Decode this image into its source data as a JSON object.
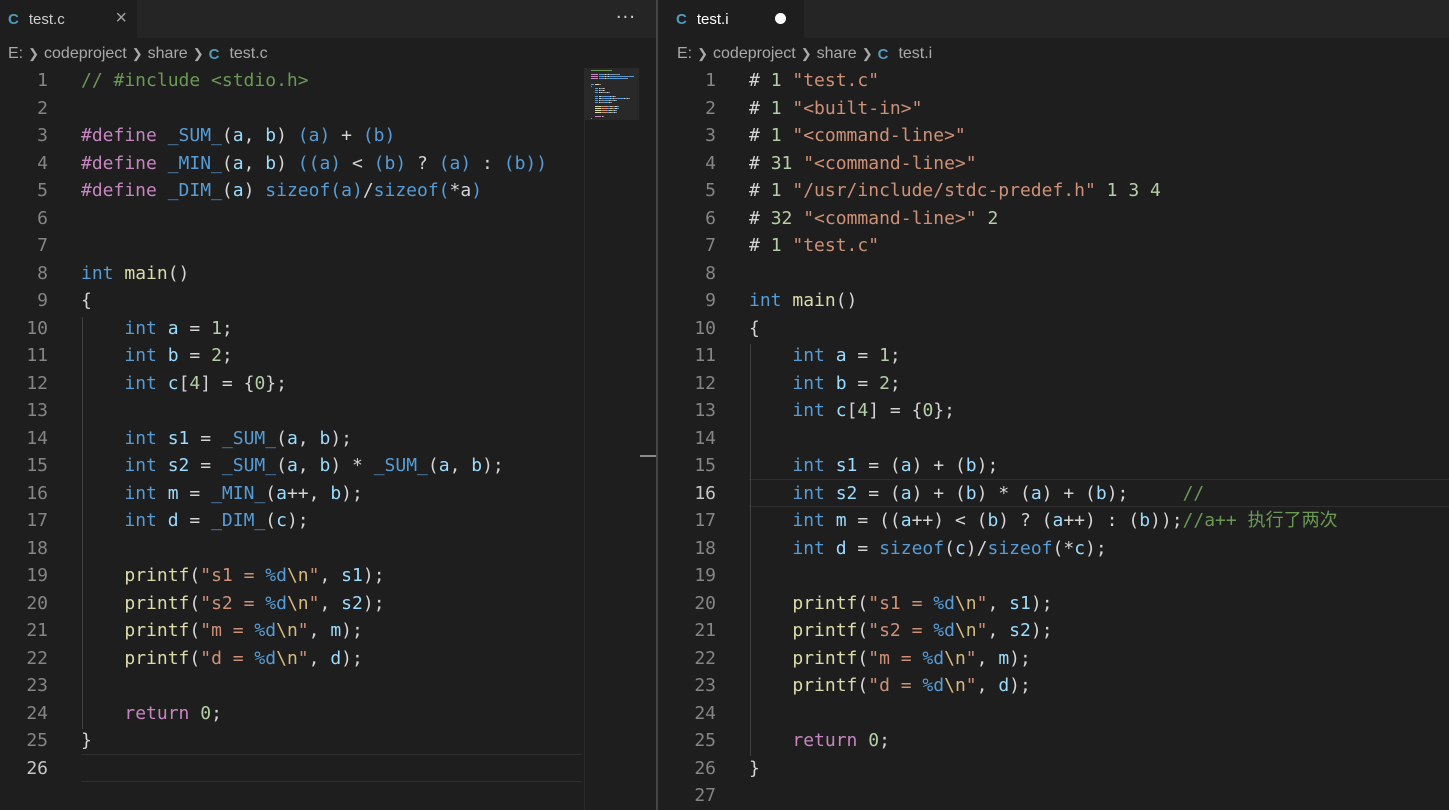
{
  "left_editor": {
    "tab": {
      "label": "test.c",
      "icon": "C",
      "close_icon": "×"
    },
    "more_actions": "···",
    "breadcrumb": {
      "drive": "E:",
      "folder1": "codeproject",
      "folder2": "share",
      "file_icon": "C",
      "file": "test.c"
    },
    "current_line": 26,
    "lines": [
      [
        [
          "// #include <stdio.h>",
          "c"
        ]
      ],
      [],
      [
        [
          "#define",
          "p"
        ],
        [
          " ",
          "t"
        ],
        [
          "_SUM_",
          "m"
        ],
        [
          "(",
          "t"
        ],
        [
          "a",
          "v"
        ],
        [
          ", ",
          "t"
        ],
        [
          "b",
          "v"
        ],
        [
          ") ",
          "t"
        ],
        [
          "(a)",
          "m"
        ],
        [
          " + ",
          "t"
        ],
        [
          "(b)",
          "m"
        ]
      ],
      [
        [
          "#define",
          "p"
        ],
        [
          " ",
          "t"
        ],
        [
          "_MIN_",
          "m"
        ],
        [
          "(",
          "t"
        ],
        [
          "a",
          "v"
        ],
        [
          ", ",
          "t"
        ],
        [
          "b",
          "v"
        ],
        [
          ") ",
          "t"
        ],
        [
          "((a)",
          "m"
        ],
        [
          " < ",
          "t"
        ],
        [
          "(b)",
          "m"
        ],
        [
          " ? ",
          "t"
        ],
        [
          "(a)",
          "m"
        ],
        [
          " : ",
          "t"
        ],
        [
          "(b))",
          "m"
        ]
      ],
      [
        [
          "#define",
          "p"
        ],
        [
          " ",
          "t"
        ],
        [
          "_DIM_",
          "m"
        ],
        [
          "(",
          "t"
        ],
        [
          "a",
          "v"
        ],
        [
          ") ",
          "t"
        ],
        [
          "sizeof(a)",
          "m"
        ],
        [
          "/",
          "t"
        ],
        [
          "sizeof(",
          "m"
        ],
        [
          "*a",
          "t"
        ],
        [
          ")",
          "m"
        ]
      ],
      [],
      [],
      [
        [
          "int",
          "k"
        ],
        [
          " ",
          "t"
        ],
        [
          "main",
          "f"
        ],
        [
          "()",
          "t"
        ]
      ],
      [
        [
          "{",
          "t"
        ]
      ],
      [
        [
          "    ",
          "t"
        ],
        [
          "int",
          "k"
        ],
        [
          " ",
          "t"
        ],
        [
          "a",
          "v"
        ],
        [
          " = ",
          "t"
        ],
        [
          "1",
          "n"
        ],
        [
          ";",
          "t"
        ]
      ],
      [
        [
          "    ",
          "t"
        ],
        [
          "int",
          "k"
        ],
        [
          " ",
          "t"
        ],
        [
          "b",
          "v"
        ],
        [
          " = ",
          "t"
        ],
        [
          "2",
          "n"
        ],
        [
          ";",
          "t"
        ]
      ],
      [
        [
          "    ",
          "t"
        ],
        [
          "int",
          "k"
        ],
        [
          " ",
          "t"
        ],
        [
          "c",
          "v"
        ],
        [
          "[",
          "t"
        ],
        [
          "4",
          "n"
        ],
        [
          "] = {",
          "t"
        ],
        [
          "0",
          "n"
        ],
        [
          "};",
          "t"
        ]
      ],
      [],
      [
        [
          "    ",
          "t"
        ],
        [
          "int",
          "k"
        ],
        [
          " ",
          "t"
        ],
        [
          "s1",
          "v"
        ],
        [
          " = ",
          "t"
        ],
        [
          "_SUM_",
          "m"
        ],
        [
          "(",
          "t"
        ],
        [
          "a",
          "v"
        ],
        [
          ", ",
          "t"
        ],
        [
          "b",
          "v"
        ],
        [
          ");",
          "t"
        ]
      ],
      [
        [
          "    ",
          "t"
        ],
        [
          "int",
          "k"
        ],
        [
          " ",
          "t"
        ],
        [
          "s2",
          "v"
        ],
        [
          " = ",
          "t"
        ],
        [
          "_SUM_",
          "m"
        ],
        [
          "(",
          "t"
        ],
        [
          "a",
          "v"
        ],
        [
          ", ",
          "t"
        ],
        [
          "b",
          "v"
        ],
        [
          ") * ",
          "t"
        ],
        [
          "_SUM_",
          "m"
        ],
        [
          "(",
          "t"
        ],
        [
          "a",
          "v"
        ],
        [
          ", ",
          "t"
        ],
        [
          "b",
          "v"
        ],
        [
          ");",
          "t"
        ]
      ],
      [
        [
          "    ",
          "t"
        ],
        [
          "int",
          "k"
        ],
        [
          " ",
          "t"
        ],
        [
          "m",
          "v"
        ],
        [
          " = ",
          "t"
        ],
        [
          "_MIN_",
          "m"
        ],
        [
          "(",
          "t"
        ],
        [
          "a",
          "v"
        ],
        [
          "++, ",
          "t"
        ],
        [
          "b",
          "v"
        ],
        [
          ");",
          "t"
        ]
      ],
      [
        [
          "    ",
          "t"
        ],
        [
          "int",
          "k"
        ],
        [
          " ",
          "t"
        ],
        [
          "d",
          "v"
        ],
        [
          " = ",
          "t"
        ],
        [
          "_DIM_",
          "m"
        ],
        [
          "(",
          "t"
        ],
        [
          "c",
          "v"
        ],
        [
          ");",
          "t"
        ]
      ],
      [],
      [
        [
          "    ",
          "t"
        ],
        [
          "printf",
          "f"
        ],
        [
          "(",
          "t"
        ],
        [
          "\"s1 = ",
          "s"
        ],
        [
          "%d",
          "k"
        ],
        [
          "\\n",
          "e"
        ],
        [
          "\"",
          "s"
        ],
        [
          ", ",
          "t"
        ],
        [
          "s1",
          "v"
        ],
        [
          ");",
          "t"
        ]
      ],
      [
        [
          "    ",
          "t"
        ],
        [
          "printf",
          "f"
        ],
        [
          "(",
          "t"
        ],
        [
          "\"s2 = ",
          "s"
        ],
        [
          "%d",
          "k"
        ],
        [
          "\\n",
          "e"
        ],
        [
          "\"",
          "s"
        ],
        [
          ", ",
          "t"
        ],
        [
          "s2",
          "v"
        ],
        [
          ");",
          "t"
        ]
      ],
      [
        [
          "    ",
          "t"
        ],
        [
          "printf",
          "f"
        ],
        [
          "(",
          "t"
        ],
        [
          "\"m = ",
          "s"
        ],
        [
          "%d",
          "k"
        ],
        [
          "\\n",
          "e"
        ],
        [
          "\"",
          "s"
        ],
        [
          ", ",
          "t"
        ],
        [
          "m",
          "v"
        ],
        [
          ");",
          "t"
        ]
      ],
      [
        [
          "    ",
          "t"
        ],
        [
          "printf",
          "f"
        ],
        [
          "(",
          "t"
        ],
        [
          "\"d = ",
          "s"
        ],
        [
          "%d",
          "k"
        ],
        [
          "\\n",
          "e"
        ],
        [
          "\"",
          "s"
        ],
        [
          ", ",
          "t"
        ],
        [
          "d",
          "v"
        ],
        [
          ");",
          "t"
        ]
      ],
      [],
      [
        [
          "    ",
          "t"
        ],
        [
          "return",
          "p"
        ],
        [
          " ",
          "t"
        ],
        [
          "0",
          "n"
        ],
        [
          ";",
          "t"
        ]
      ],
      [
        [
          "}",
          "t"
        ]
      ],
      []
    ]
  },
  "right_editor": {
    "tab": {
      "label": "test.i",
      "icon": "C",
      "dirty_icon": "●"
    },
    "breadcrumb": {
      "drive": "E:",
      "folder1": "codeproject",
      "folder2": "share",
      "file_icon": "C",
      "file": "test.i"
    },
    "current_line": 16,
    "lines": [
      [
        [
          "# ",
          "t"
        ],
        [
          "1",
          "n"
        ],
        [
          " ",
          "t"
        ],
        [
          "\"test.c\"",
          "s"
        ]
      ],
      [
        [
          "# ",
          "t"
        ],
        [
          "1",
          "n"
        ],
        [
          " ",
          "t"
        ],
        [
          "\"<built-in>\"",
          "s"
        ]
      ],
      [
        [
          "# ",
          "t"
        ],
        [
          "1",
          "n"
        ],
        [
          " ",
          "t"
        ],
        [
          "\"<command-line>\"",
          "s"
        ]
      ],
      [
        [
          "# ",
          "t"
        ],
        [
          "31",
          "n"
        ],
        [
          " ",
          "t"
        ],
        [
          "\"<command-line>\"",
          "s"
        ]
      ],
      [
        [
          "# ",
          "t"
        ],
        [
          "1",
          "n"
        ],
        [
          " ",
          "t"
        ],
        [
          "\"/usr/include/stdc-predef.h\"",
          "s"
        ],
        [
          " ",
          "t"
        ],
        [
          "1",
          "n"
        ],
        [
          " ",
          "t"
        ],
        [
          "3",
          "n"
        ],
        [
          " ",
          "t"
        ],
        [
          "4",
          "n"
        ]
      ],
      [
        [
          "# ",
          "t"
        ],
        [
          "32",
          "n"
        ],
        [
          " ",
          "t"
        ],
        [
          "\"<command-line>\"",
          "s"
        ],
        [
          " ",
          "t"
        ],
        [
          "2",
          "n"
        ]
      ],
      [
        [
          "# ",
          "t"
        ],
        [
          "1",
          "n"
        ],
        [
          " ",
          "t"
        ],
        [
          "\"test.c\"",
          "s"
        ]
      ],
      [],
      [
        [
          "int",
          "k"
        ],
        [
          " ",
          "t"
        ],
        [
          "main",
          "f"
        ],
        [
          "()",
          "t"
        ]
      ],
      [
        [
          "{",
          "t"
        ]
      ],
      [
        [
          "    ",
          "t"
        ],
        [
          "int",
          "k"
        ],
        [
          " ",
          "t"
        ],
        [
          "a",
          "v"
        ],
        [
          " = ",
          "t"
        ],
        [
          "1",
          "n"
        ],
        [
          ";",
          "t"
        ]
      ],
      [
        [
          "    ",
          "t"
        ],
        [
          "int",
          "k"
        ],
        [
          " ",
          "t"
        ],
        [
          "b",
          "v"
        ],
        [
          " = ",
          "t"
        ],
        [
          "2",
          "n"
        ],
        [
          ";",
          "t"
        ]
      ],
      [
        [
          "    ",
          "t"
        ],
        [
          "int",
          "k"
        ],
        [
          " ",
          "t"
        ],
        [
          "c",
          "v"
        ],
        [
          "[",
          "t"
        ],
        [
          "4",
          "n"
        ],
        [
          "] = {",
          "t"
        ],
        [
          "0",
          "n"
        ],
        [
          "};",
          "t"
        ]
      ],
      [],
      [
        [
          "    ",
          "t"
        ],
        [
          "int",
          "k"
        ],
        [
          " ",
          "t"
        ],
        [
          "s1",
          "v"
        ],
        [
          " = (",
          "t"
        ],
        [
          "a",
          "v"
        ],
        [
          ") + (",
          "t"
        ],
        [
          "b",
          "v"
        ],
        [
          ");",
          "t"
        ]
      ],
      [
        [
          "    ",
          "t"
        ],
        [
          "int",
          "k"
        ],
        [
          " ",
          "t"
        ],
        [
          "s2",
          "v"
        ],
        [
          " = (",
          "t"
        ],
        [
          "a",
          "v"
        ],
        [
          ") + (",
          "t"
        ],
        [
          "b",
          "v"
        ],
        [
          ") * (",
          "t"
        ],
        [
          "a",
          "v"
        ],
        [
          ") + (",
          "t"
        ],
        [
          "b",
          "v"
        ],
        [
          ");     ",
          "t"
        ],
        [
          "//",
          "c"
        ]
      ],
      [
        [
          "    ",
          "t"
        ],
        [
          "int",
          "k"
        ],
        [
          " ",
          "t"
        ],
        [
          "m",
          "v"
        ],
        [
          " = ((",
          "t"
        ],
        [
          "a",
          "v"
        ],
        [
          "++) < (",
          "t"
        ],
        [
          "b",
          "v"
        ],
        [
          ") ? (",
          "t"
        ],
        [
          "a",
          "v"
        ],
        [
          "++) : (",
          "t"
        ],
        [
          "b",
          "v"
        ],
        [
          "));",
          "t"
        ],
        [
          "//a++ 执行了两次",
          "c"
        ]
      ],
      [
        [
          "    ",
          "t"
        ],
        [
          "int",
          "k"
        ],
        [
          " ",
          "t"
        ],
        [
          "d",
          "v"
        ],
        [
          " = ",
          "t"
        ],
        [
          "sizeof",
          "k"
        ],
        [
          "(",
          "t"
        ],
        [
          "c",
          "v"
        ],
        [
          ")/",
          "t"
        ],
        [
          "sizeof",
          "k"
        ],
        [
          "(*",
          "t"
        ],
        [
          "c",
          "v"
        ],
        [
          ");",
          "t"
        ]
      ],
      [],
      [
        [
          "    ",
          "t"
        ],
        [
          "printf",
          "f"
        ],
        [
          "(",
          "t"
        ],
        [
          "\"s1 = ",
          "s"
        ],
        [
          "%d",
          "k"
        ],
        [
          "\\n",
          "e"
        ],
        [
          "\"",
          "s"
        ],
        [
          ", ",
          "t"
        ],
        [
          "s1",
          "v"
        ],
        [
          ");",
          "t"
        ]
      ],
      [
        [
          "    ",
          "t"
        ],
        [
          "printf",
          "f"
        ],
        [
          "(",
          "t"
        ],
        [
          "\"s2 = ",
          "s"
        ],
        [
          "%d",
          "k"
        ],
        [
          "\\n",
          "e"
        ],
        [
          "\"",
          "s"
        ],
        [
          ", ",
          "t"
        ],
        [
          "s2",
          "v"
        ],
        [
          ");",
          "t"
        ]
      ],
      [
        [
          "    ",
          "t"
        ],
        [
          "printf",
          "f"
        ],
        [
          "(",
          "t"
        ],
        [
          "\"m = ",
          "s"
        ],
        [
          "%d",
          "k"
        ],
        [
          "\\n",
          "e"
        ],
        [
          "\"",
          "s"
        ],
        [
          ", ",
          "t"
        ],
        [
          "m",
          "v"
        ],
        [
          ");",
          "t"
        ]
      ],
      [
        [
          "    ",
          "t"
        ],
        [
          "printf",
          "f"
        ],
        [
          "(",
          "t"
        ],
        [
          "\"d = ",
          "s"
        ],
        [
          "%d",
          "k"
        ],
        [
          "\\n",
          "e"
        ],
        [
          "\"",
          "s"
        ],
        [
          ", ",
          "t"
        ],
        [
          "d",
          "v"
        ],
        [
          ");",
          "t"
        ]
      ],
      [],
      [
        [
          "    ",
          "t"
        ],
        [
          "return",
          "p"
        ],
        [
          " ",
          "t"
        ],
        [
          "0",
          "n"
        ],
        [
          ";",
          "t"
        ]
      ],
      [
        [
          "}",
          "t"
        ]
      ],
      []
    ]
  }
}
